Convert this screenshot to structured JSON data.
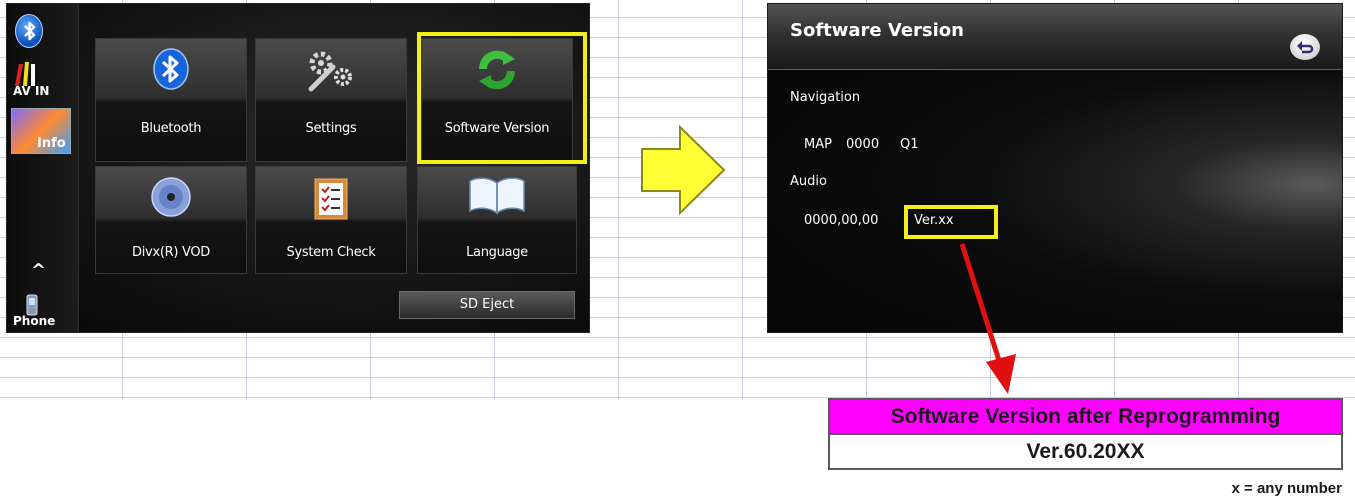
{
  "menu_screen": {
    "side_items": {
      "av_in": "AV IN",
      "info": "Info",
      "up_arrow": "^",
      "phone": "Phone"
    },
    "tiles": [
      {
        "label": "Bluetooth",
        "icon": "bluetooth-icon"
      },
      {
        "label": "Settings",
        "icon": "wrench-gear-icon"
      },
      {
        "label": "Software Version",
        "icon": "refresh-arrows-icon",
        "highlighted": true
      },
      {
        "label": "Divx(R) VOD",
        "icon": "disc-icon"
      },
      {
        "label": "System Check",
        "icon": "checklist-icon"
      },
      {
        "label": "Language",
        "icon": "book-icon"
      }
    ],
    "sd_eject": "SD Eject"
  },
  "software_screen": {
    "title": "Software Version",
    "navigation_label": "Navigation",
    "map_label": "MAP",
    "map_value": "0000",
    "map_region": "Q1",
    "audio_label": "Audio",
    "audio_value": "0000,00,00",
    "audio_version": "Ver.xx"
  },
  "result_table": {
    "header": "Software Version after Reprogramming",
    "value": "Ver.60.20XX"
  },
  "footnote": "x = any number",
  "colors": {
    "highlight": "#f3f017",
    "table_header": "#ff00ff",
    "pointer": "#e01010"
  }
}
